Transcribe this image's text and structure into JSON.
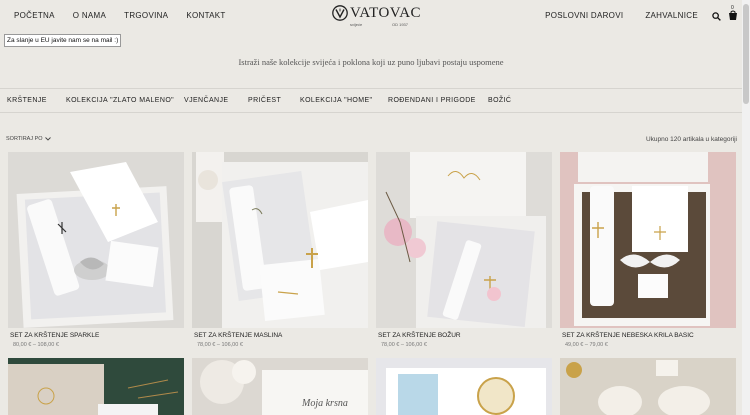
{
  "nav": {
    "left": [
      "POČETNA",
      "O NAMA",
      "TRGOVINA",
      "KONTAKT"
    ],
    "right": [
      "POSLOVNI DAROVI",
      "ZAHVALNICE"
    ]
  },
  "logo": {
    "text": "VATOVAC",
    "sub": "svijeće",
    "est": "OD 1937"
  },
  "cart": {
    "count": "0"
  },
  "notice": "Za slanje u EU javite nam se na mail :)",
  "tagline": "Istraži naše kolekcije svijeća i poklona koji uz puno ljubavi postaju uspomene",
  "categories": [
    "KRŠTENJE",
    "KOLEKCIJA \"ZLATO MALENO\"",
    "VJENČANJE",
    "PRIČEST",
    "KOLEKCIJA \"HOME\"",
    "ROĐENDANI I PRIGODE",
    "BOŽIĆ"
  ],
  "sort_label": "SORTIRAJ PO",
  "result_count": "Ukupno 120 artikala u kategoriji",
  "products": [
    {
      "name": "SET ZA KRŠTENJE SPARKLE",
      "price": "80,00 € – 108,00 €"
    },
    {
      "name": "SET ZA KRŠTENJE MASLINA",
      "price": "78,00 € – 106,00 €"
    },
    {
      "name": "SET ZA KRŠTENJE BOŽUR",
      "price": "78,00 € – 106,00 €"
    },
    {
      "name": "SET ZA KRŠTENJE NEBESKA KRILA BASIC",
      "price": "49,00 € – 79,00 €"
    }
  ],
  "second_row": {
    "card2_text": "Moja krsna"
  },
  "colors": {
    "background": "#ebe9e4",
    "accent": "#c9a24a",
    "text": "#222222"
  },
  "icons": [
    "search-icon",
    "cart-icon",
    "chevron-down-icon",
    "cross-icon"
  ]
}
